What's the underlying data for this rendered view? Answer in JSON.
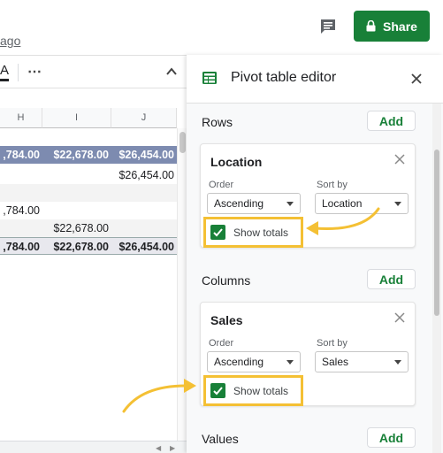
{
  "header": {
    "last_edit": "ago",
    "share_label": "Share",
    "comment_icon": "comment-icon",
    "lock_icon": "lock-icon"
  },
  "toolbar": {
    "text_color_label": "A",
    "more_label": "⋯",
    "collapse_icon": "chevron-up-icon"
  },
  "sheet": {
    "columns": [
      "H",
      "I",
      "J"
    ],
    "rows": [
      {
        "style": "hdr",
        "cells": [
          ",784.00",
          "$22,678.00",
          "$26,454.00"
        ]
      },
      {
        "style": "plain",
        "cells": [
          "",
          "",
          "$26,454.00"
        ]
      },
      {
        "style": "band",
        "cells": [
          "",
          "",
          ""
        ]
      },
      {
        "style": "plain",
        "cells": [
          ",784.00",
          "",
          ""
        ]
      },
      {
        "style": "band",
        "cells": [
          "",
          "$22,678.00",
          ""
        ]
      },
      {
        "style": "total",
        "cells": [
          ",784.00",
          "$22,678.00",
          "$26,454.00"
        ]
      }
    ]
  },
  "panel": {
    "title": "Pivot table editor",
    "icon": "pivot-table-icon",
    "rows_section": {
      "label": "Rows",
      "add_label": "Add",
      "card": {
        "title": "Location",
        "order_label": "Order",
        "order_value": "Ascending",
        "sort_label": "Sort by",
        "sort_value": "Location",
        "show_totals_label": "Show totals",
        "show_totals_checked": true
      }
    },
    "columns_section": {
      "label": "Columns",
      "add_label": "Add",
      "card": {
        "title": "Sales",
        "order_label": "Order",
        "order_value": "Ascending",
        "sort_label": "Sort by",
        "sort_value": "Sales",
        "show_totals_label": "Show totals",
        "show_totals_checked": true
      }
    },
    "values_section": {
      "label": "Values",
      "add_label": "Add"
    }
  },
  "colors": {
    "accent_green": "#188038",
    "highlight_yellow": "#f4c034",
    "header_row": "#7d8bb0"
  }
}
